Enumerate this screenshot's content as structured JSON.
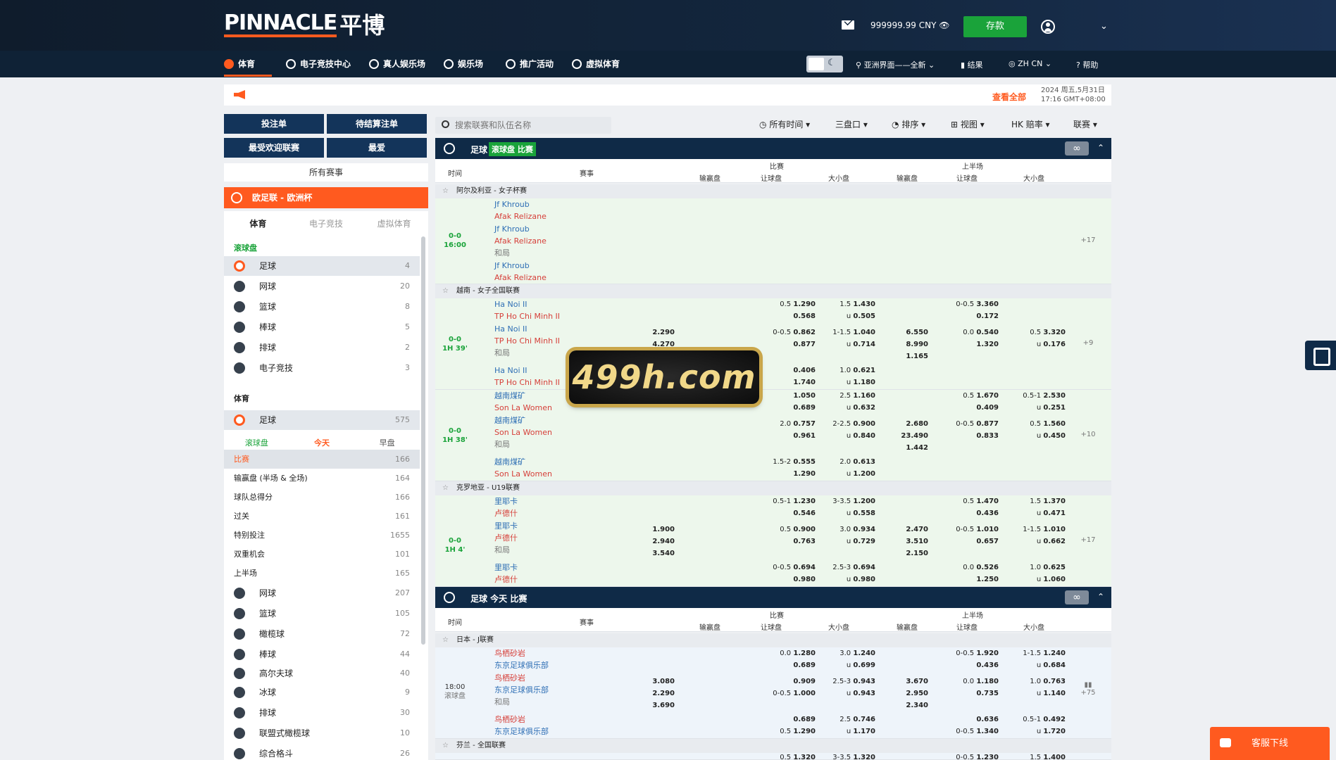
{
  "brand": {
    "name": "PINNACLE",
    "cn": "平博"
  },
  "header": {
    "balance": "999999.99 CNY",
    "deposit": "存款"
  },
  "nav": [
    {
      "label": "体育"
    },
    {
      "label": "电子竞技中心"
    },
    {
      "label": "真人娱乐场"
    },
    {
      "label": "娱乐场"
    },
    {
      "label": "推广活动"
    },
    {
      "label": "虚拟体育"
    }
  ],
  "nav_right": {
    "view": "亚洲界面——全新",
    "results": "结果",
    "lang": "ZH CN",
    "help": "帮助"
  },
  "announce": {
    "viewall": "查看全部",
    "date": "2024 周五,5月31日",
    "time": "17:16 GMT+08:00"
  },
  "left_buttons": {
    "betslip": "投注单",
    "pending": "待结算注单",
    "popular": "最受欢迎联赛",
    "fav": "最爱"
  },
  "all_matches": "所有赛事",
  "featured": "欧足联 - 欧洲杯",
  "side_tabs": [
    "体育",
    "电子竞技",
    "虚拟体育"
  ],
  "live_label": "滚球盘",
  "live_sports": [
    {
      "name": "足球",
      "count": "4"
    },
    {
      "name": "网球",
      "count": "20"
    },
    {
      "name": "篮球",
      "count": "8"
    },
    {
      "name": "棒球",
      "count": "5"
    },
    {
      "name": "排球",
      "count": "2"
    },
    {
      "name": "电子竞技",
      "count": "3"
    }
  ],
  "sports_label": "体育",
  "soccer": {
    "name": "足球",
    "count": "575"
  },
  "sub_tabs": [
    "滚球盘",
    "今天",
    "早盘"
  ],
  "markets": [
    {
      "name": "比赛",
      "count": "166"
    },
    {
      "name": "输赢盘 (半场 & 全场)",
      "count": "164"
    },
    {
      "name": "球队总得分",
      "count": "166"
    },
    {
      "name": "过关",
      "count": "161"
    },
    {
      "name": "特别投注",
      "count": "1655"
    },
    {
      "name": "双重机会",
      "count": "101"
    },
    {
      "name": "上半场",
      "count": "165"
    }
  ],
  "other_sports": [
    {
      "name": "网球",
      "count": "207"
    },
    {
      "name": "篮球",
      "count": "105"
    },
    {
      "name": "橄榄球",
      "count": "72"
    },
    {
      "name": "棒球",
      "count": "44"
    },
    {
      "name": "高尔夫球",
      "count": "40"
    },
    {
      "name": "冰球",
      "count": "9"
    },
    {
      "name": "排球",
      "count": "30"
    },
    {
      "name": "联盟式橄榄球",
      "count": "10"
    },
    {
      "name": "综合格斗",
      "count": "26"
    }
  ],
  "search": {
    "placeholder": "搜索联赛和队伍名称"
  },
  "filters": {
    "time": "所有时间",
    "lines": "三盘口",
    "sort": "排序",
    "view": "视图",
    "odds": "HK 赔率",
    "league": "联赛"
  },
  "sections": [
    {
      "sport": "足球",
      "tag": "滚球盘 比赛"
    },
    {
      "sport": "足球 今天 比赛"
    }
  ],
  "columns": {
    "time": "时间",
    "event": "赛事",
    "full": "比赛",
    "half": "上半场",
    "ml": "输赢盘",
    "hdp": "让球盘",
    "ou": "大小盘"
  },
  "watermark": "499h.com",
  "chat": "客服下线",
  "leagues": [
    {
      "name": "阿尔及利亚 - 女子杯赛",
      "score": "0-0",
      "time": "16:00",
      "more": "+17",
      "lines": [
        {
          "h": "Jf Khroub",
          "a": "Afak Relizane",
          "d": ""
        },
        {
          "h": "Jf Khroub",
          "a": "Afak Relizane",
          "d": "和局"
        },
        {
          "h": "Jf Khroub",
          "a": "Afak Relizane",
          "d": ""
        }
      ]
    },
    {
      "name": "越南 - 女子全国联赛",
      "score": "0-0",
      "time": "1H 39'",
      "more": "+9",
      "lines": [
        {
          "h": "Ha Noi II",
          "a": "TP Ho Chi Minh II",
          "d": ""
        },
        {
          "h": "Ha Noi II",
          "a": "TP Ho Chi Minh II",
          "d": "和局"
        },
        {
          "h": "Ha Noi II",
          "a": "TP Ho Chi Minh II",
          "d": ""
        }
      ]
    },
    {
      "name": "",
      "score": "0-0",
      "time": "1H 38'",
      "more": "+10",
      "lines": [
        {
          "h": "越南煤矿",
          "a": "Son La Women",
          "d": ""
        },
        {
          "h": "越南煤矿",
          "a": "Son La Women",
          "d": "和局"
        },
        {
          "h": "越南煤矿",
          "a": "Son La Women",
          "d": ""
        }
      ]
    },
    {
      "name": "克罗地亚 - U19联赛",
      "score": "0-0",
      "time": "1H 4'",
      "more": "+17",
      "lines": [
        {
          "h": "里耶卡",
          "a": "卢德什",
          "d": ""
        },
        {
          "h": "里耶卡",
          "a": "卢德什",
          "d": "和局"
        },
        {
          "h": "里耶卡",
          "a": "卢德什",
          "d": ""
        }
      ]
    },
    {
      "name": "日本 - J联赛",
      "score": "18:00",
      "time": "滚球盘",
      "more": "+75",
      "lines": [
        {
          "h": "鸟栖砂岩",
          "a": "东京足球俱乐部",
          "d": ""
        },
        {
          "h": "鸟栖砂岩",
          "a": "东京足球俱乐部",
          "d": "和局"
        },
        {
          "h": "鸟栖砂岩",
          "a": "东京足球俱乐部",
          "d": ""
        }
      ]
    },
    {
      "name": "芬兰 - 全国联赛"
    }
  ],
  "odds_text": {
    "l2a": [
      "0.5",
      "1.290",
      "0.568",
      "1.5",
      "1.430",
      "u",
      "0.505",
      "0-0.5",
      "3.360",
      "0.172"
    ],
    "l2b": [
      "2.290",
      "4.270",
      "0-0.5",
      "0.862",
      "0.877",
      "1-1.5",
      "1.040",
      "u",
      "0.714",
      "6.550",
      "8.990",
      "1.165",
      "0.0",
      "0.540",
      "1.320",
      "0.5",
      "3.320",
      "u",
      "0.176"
    ],
    "l2c": [
      "0.406",
      "1.740",
      "1.0",
      "0.621",
      "u",
      "1.180"
    ],
    "l3a": [
      "1.050",
      "0.689",
      "2.5",
      "1.160",
      "u",
      "0.632",
      "0.5",
      "1.670",
      "0.409",
      "0.5-1",
      "2.530",
      "u",
      "0.251"
    ],
    "l3b": [
      "2.0",
      "0.757",
      "0.961",
      "2-2.5",
      "0.900",
      "u",
      "0.840",
      "2.680",
      "23.490",
      "1.442",
      "0-0.5",
      "0.877",
      "0.833",
      "0.5",
      "1.560",
      "u",
      "0.450"
    ],
    "l3c": [
      "1.5-2",
      "0.555",
      "1.290",
      "2.0",
      "0.613",
      "u",
      "1.200"
    ],
    "l4a": [
      "0.5-1",
      "1.230",
      "0.546",
      "3-3.5",
      "1.200",
      "u",
      "0.558",
      "0.5",
      "1.470",
      "0.436",
      "1.5",
      "1.370",
      "u",
      "0.471"
    ],
    "l4b": [
      "1.900",
      "2.940",
      "3.540",
      "0.5",
      "0.900",
      "0.763",
      "3.0",
      "0.934",
      "u",
      "0.729",
      "2.470",
      "3.510",
      "2.150",
      "0-0.5",
      "1.010",
      "0.657",
      "1-1.5",
      "1.010",
      "u",
      "0.662"
    ],
    "l4c": [
      "0-0.5",
      "0.694",
      "0.980",
      "2.5-3",
      "0.694",
      "u",
      "0.980",
      "0.0",
      "0.526",
      "1.250",
      "1.0",
      "0.625",
      "u",
      "1.060"
    ],
    "l5a": [
      "0.0",
      "1.280",
      "0.689",
      "3.0",
      "1.240",
      "u",
      "0.699",
      "0-0.5",
      "1.920",
      "0.436",
      "1-1.5",
      "1.240",
      "u",
      "0.684"
    ],
    "l5b": [
      "3.080",
      "2.290",
      "3.690",
      "0.909",
      "0-0.5",
      "1.000",
      "2.5-3",
      "0.943",
      "u",
      "0.943",
      "3.670",
      "2.950",
      "2.340",
      "0.0",
      "1.180",
      "0.735",
      "1.0",
      "0.763",
      "u",
      "1.140"
    ],
    "l5c": [
      "0.689",
      "0.5",
      "1.290",
      "2.5",
      "0.746",
      "u",
      "1.170",
      "0.636",
      "0-0.5",
      "1.340",
      "0.5-1",
      "0.492",
      "u",
      "1.720"
    ],
    "l6": [
      "0.5",
      "1.320",
      "3-3.5",
      "1.320",
      "0-0.5",
      "1.230",
      "1.5",
      "1.400"
    ]
  }
}
